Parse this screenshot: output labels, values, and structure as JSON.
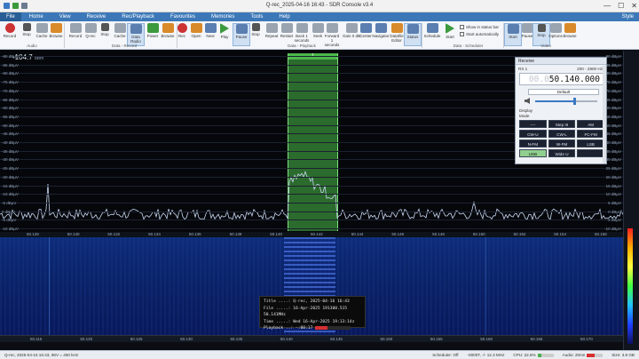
{
  "window": {
    "title": "Q-rec_2025-04-16 16:43 - SDR Console v3.4",
    "controls": [
      "—",
      "☐",
      "✕"
    ]
  },
  "menu": {
    "file": "File",
    "items": [
      "Home",
      "View",
      "Receive",
      "Rec/Playback",
      "Favourites",
      "Memories",
      "Tools",
      "Help"
    ],
    "style": "Style"
  },
  "ribbon": {
    "buttons": [
      {
        "label": "Record",
        "icon": "record-icon"
      },
      {
        "label": "Stop",
        "icon": "stop-icon"
      },
      {
        "label": "Cache",
        "icon": "cache-icon"
      },
      {
        "label": "Browse",
        "icon": "browse-icon"
      },
      {
        "label": "Record",
        "icon": "record-icon"
      },
      {
        "label": "Q-rec",
        "icon": "qrec-icon"
      },
      {
        "label": "Stop",
        "icon": "stop-icon"
      },
      {
        "label": "Cache",
        "icon": "cache-icon"
      },
      {
        "label": "Data Radio",
        "icon": "data-radio-icon"
      },
      {
        "label": "Power",
        "icon": "power-icon"
      },
      {
        "label": "Browse",
        "icon": "browse-icon"
      },
      {
        "label": "Rec",
        "icon": "rec-icon"
      },
      {
        "label": "Open",
        "icon": "open-icon"
      },
      {
        "label": "Next",
        "icon": "next-icon"
      },
      {
        "label": "Play",
        "icon": "play-icon"
      },
      {
        "label": "Pause",
        "icon": "pause-icon"
      },
      {
        "label": "Stop",
        "icon": "stop-icon"
      },
      {
        "label": "Repeat",
        "icon": "repeat-icon"
      },
      {
        "label": "Restart",
        "icon": "restart-icon"
      },
      {
        "label": "Back 1 seconds",
        "icon": "back-icon"
      },
      {
        "label": "Seek",
        "icon": "seek-icon"
      },
      {
        "label": "Forward 1 seconds",
        "icon": "forward-icon"
      },
      {
        "label": "Gain 0 dB",
        "icon": "gain-icon"
      },
      {
        "label": "Center",
        "icon": "center-icon"
      },
      {
        "label": "Navigator",
        "icon": "navigator-icon"
      },
      {
        "label": "Datafile Editor",
        "icon": "datafile-editor-icon"
      },
      {
        "label": "Status",
        "icon": "status-icon"
      },
      {
        "label": "Schedule",
        "icon": "schedule-icon"
      },
      {
        "label": "Start",
        "icon": "start-icon"
      },
      {
        "label": "Start",
        "icon": "start-icon"
      },
      {
        "label": "Pause",
        "icon": "pause-icon"
      },
      {
        "label": "Stop",
        "icon": "stop-icon"
      },
      {
        "label": "Options",
        "icon": "options-icon"
      },
      {
        "label": "Browse",
        "icon": "browse-icon"
      }
    ],
    "groups": {
      "audio": "Audio",
      "data_record": "Data - Record",
      "data_playback": "Data - Playback",
      "data_scheduler": "Data - Scheduler",
      "video": "Video"
    },
    "checks": {
      "show_status_bar": "Show in status bar",
      "start_automatically": "Start automatically"
    }
  },
  "spectrum": {
    "level": "-104.7",
    "unit": "dBm",
    "db_labels_left": [
      "-80 dBµV",
      "-85 dBµV",
      "-80 dBµV",
      "-75 dBµV",
      "-70 dBµV",
      "-65 dBµV",
      "-60 dBµV",
      "-55 dBµV",
      "-50 dBµV",
      "-45 dBµV",
      "-40 dBµV",
      "-35 dBµV",
      "-30 dBµV",
      "-25 dBµV",
      "-20 dBµV",
      "-15 dBµV",
      "-10 dBµV",
      "-5 dBµV",
      "0 dBµV",
      "-5 dBµV",
      "-10 dBµV"
    ],
    "db_labels_right": [
      "90 dBµV",
      "85 dBµV",
      "80 dBµV",
      "75 dBµV",
      "70 dBµV",
      "65 dBµV",
      "60 dBµV",
      "55 dBµV",
      "50 dBµV",
      "45 dBµV",
      "40 dBµV",
      "35 dBµV",
      "30 dBµV",
      "25 dBµV",
      "20 dBµV",
      "15 dBµV",
      "10 dBµV",
      "5 dBµV",
      "0 dBµV",
      "-5 dBµV",
      "-10 dBµV"
    ],
    "freq_ticks": [
      "50.128",
      "50.130",
      "50.132",
      "50.134",
      "50.136",
      "50.138",
      "50.140",
      "50.142",
      "50.144",
      "50.146",
      "50.148",
      "50.150",
      "50.152",
      "50.154",
      "50.156"
    ],
    "filter_label": "1"
  },
  "waterfall": {
    "freq_ticks": [
      "50.115",
      "50.120",
      "50.125",
      "50.130",
      "50.135",
      "50.140",
      "50.145",
      "50.150",
      "50.155",
      "50.160",
      "50.165",
      "50.170"
    ]
  },
  "playback_info": {
    "title": "Title ....: Q-rec, 2025-04-16 16:43",
    "file": "File .....: 16-Apr-2025 191300.515 50.141MHz",
    "time": "Time .....: Wed 16-Apr-2025 19:13:14z",
    "playback": "Playback ..: -:00:17",
    "progress": 0.35
  },
  "receive": {
    "title": "Receive",
    "rx": "RX 1",
    "range": "200 - 2800 Hz",
    "freq_dim": "00.0",
    "freq_main": "50.140.000",
    "preset": "Default",
    "volume": 0.62,
    "display": "Display",
    "mode_label": "Mode",
    "modes": [
      "----",
      "Step III",
      "AM",
      "CW-U",
      "CW-L",
      "FC-FM",
      "N-FM",
      "W-FM",
      "LSB",
      "USB",
      "Wide U",
      ""
    ],
    "active_mode": "USB"
  },
  "status": {
    "left": "Q-rec, 2025-04-16 16:43, 96V = 450 kHz",
    "scheduler": "Scheduler: Off",
    "level": "-0000T, -/- 12.3 MHz",
    "cpu": "CPU: 22.8%",
    "audio": "Audio: 20ms",
    "size": "Size: 3.8 GB",
    "cpu_fraction": 0.23,
    "audio_fraction": 0.5,
    "cpu_color": "#4caf50",
    "audio_color": "#d63030"
  }
}
